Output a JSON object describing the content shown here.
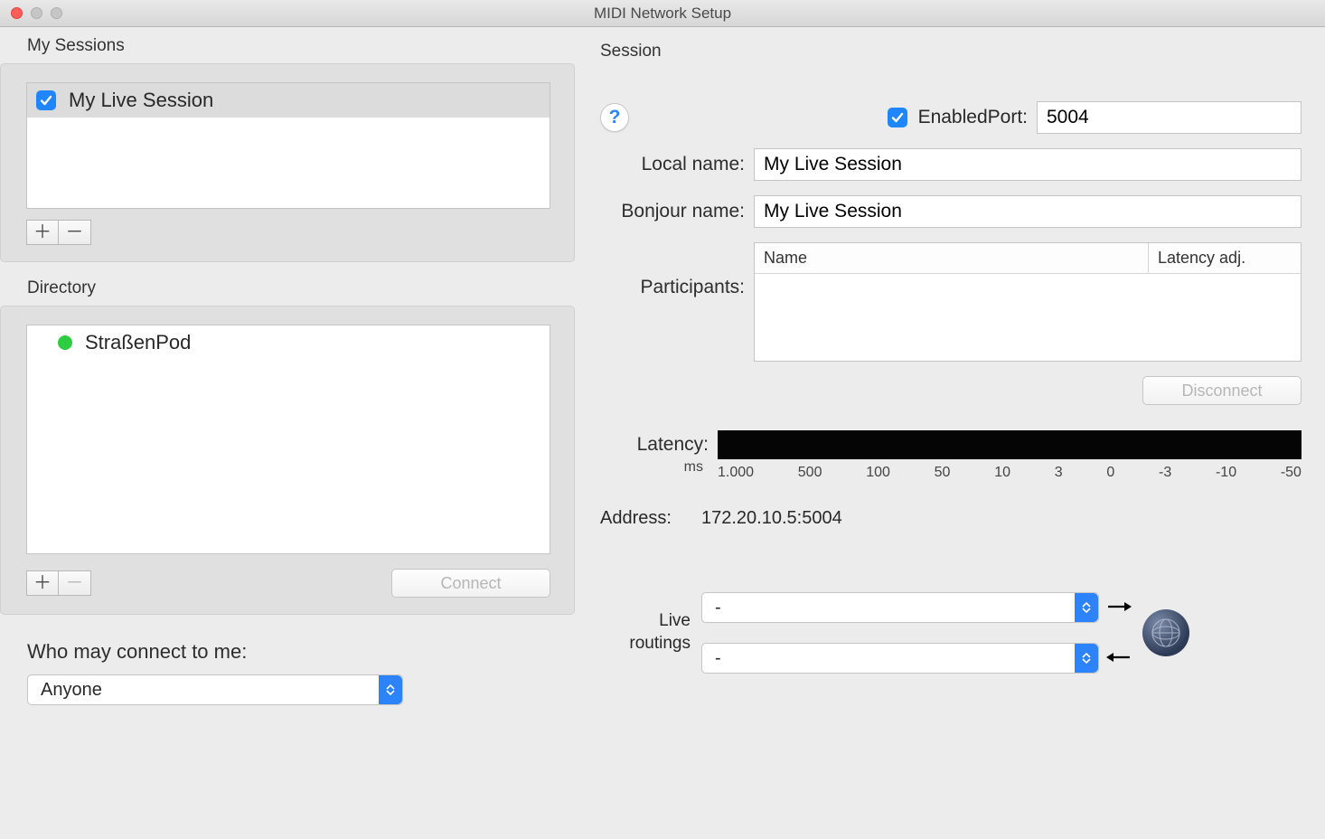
{
  "window": {
    "title": "MIDI Network Setup"
  },
  "left": {
    "sessions_heading": "My Sessions",
    "sessions": [
      {
        "label": "My Live Session",
        "checked": true
      }
    ],
    "directory_heading": "Directory",
    "directory": [
      {
        "label": "StraßenPod",
        "online": true
      }
    ],
    "connect_label": "Connect",
    "who_heading": "Who may connect to me:",
    "who_value": "Anyone"
  },
  "right": {
    "session_heading": "Session",
    "enabled_label": "Enabled",
    "port_label": "Port:",
    "port_value": "5004",
    "local_name_label": "Local name:",
    "local_name_value": "My Live Session",
    "bonjour_label": "Bonjour name:",
    "bonjour_value": "My Live Session",
    "participants_label": "Participants:",
    "part_col_name": "Name",
    "part_col_lat": "Latency adj.",
    "disconnect_label": "Disconnect",
    "latency_label": "Latency:",
    "latency_unit": "ms",
    "latency_ticks": [
      "1.000",
      "500",
      "100",
      "50",
      "10",
      "3",
      "0",
      "-3",
      "-10",
      "-50"
    ],
    "address_label": "Address:",
    "address_value": "172.20.10.5:5004",
    "routings_label_line1": "Live",
    "routings_label_line2": "routings",
    "routing_in": "-",
    "routing_out": "-"
  },
  "glyphs": {
    "plus": "＋",
    "minus": "－",
    "help": "?"
  }
}
